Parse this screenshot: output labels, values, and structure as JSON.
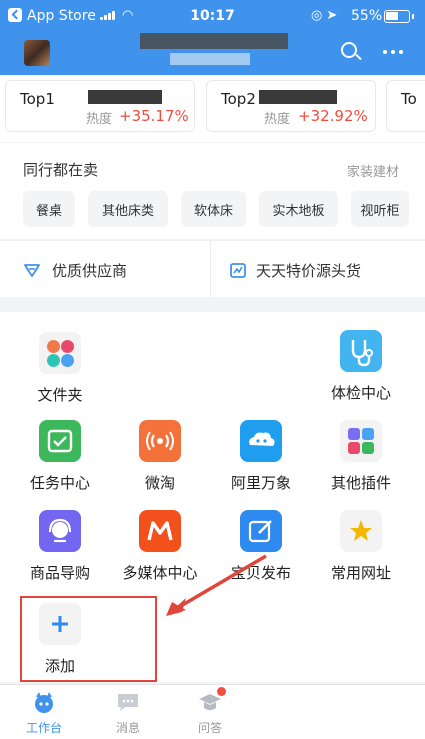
{
  "status_bar": {
    "back_app": "App Store",
    "time": "10:17",
    "battery": "55%"
  },
  "top_cards": [
    {
      "rank": "Top1",
      "heat_label": "热度",
      "change": "+35.17%"
    },
    {
      "rank": "Top2",
      "heat_label": "热度",
      "change": "+32.92%"
    },
    {
      "rank": "To"
    }
  ],
  "peers": {
    "heading": "同行都在卖",
    "category": "家装建材",
    "chips": [
      "餐桌",
      "其他床类",
      "软体床",
      "实木地板",
      "视听柜"
    ]
  },
  "supply": {
    "left": "优质供应商",
    "right": "天天特价源头货"
  },
  "apps": [
    {
      "label": "文件夹",
      "icon": "folder-icon"
    },
    {
      "label": "体检中心",
      "icon": "stethoscope-icon"
    },
    {
      "label": "任务中心",
      "icon": "calendar-check-icon"
    },
    {
      "label": "微淘",
      "icon": "broadcast-icon"
    },
    {
      "label": "阿里万象",
      "icon": "cloud-face-icon"
    },
    {
      "label": "其他插件",
      "icon": "plugin-grid-icon"
    },
    {
      "label": "商品导购",
      "icon": "headset-icon"
    },
    {
      "label": "多媒体中心",
      "icon": "media-m-icon"
    },
    {
      "label": "宝贝发布",
      "icon": "edit-icon"
    },
    {
      "label": "常用网址",
      "icon": "star-icon"
    },
    {
      "label": "添加",
      "icon": "plus-icon"
    }
  ],
  "tabs": [
    {
      "label": "工作台",
      "icon": "workbench-icon",
      "active": true
    },
    {
      "label": "消息",
      "icon": "message-icon",
      "active": false
    },
    {
      "label": "问答",
      "icon": "graduation-cap-icon",
      "active": false
    }
  ],
  "colors": {
    "brand": "#3f93ec",
    "accent_red": "#f24c3d",
    "highlight": "#e0463c"
  }
}
